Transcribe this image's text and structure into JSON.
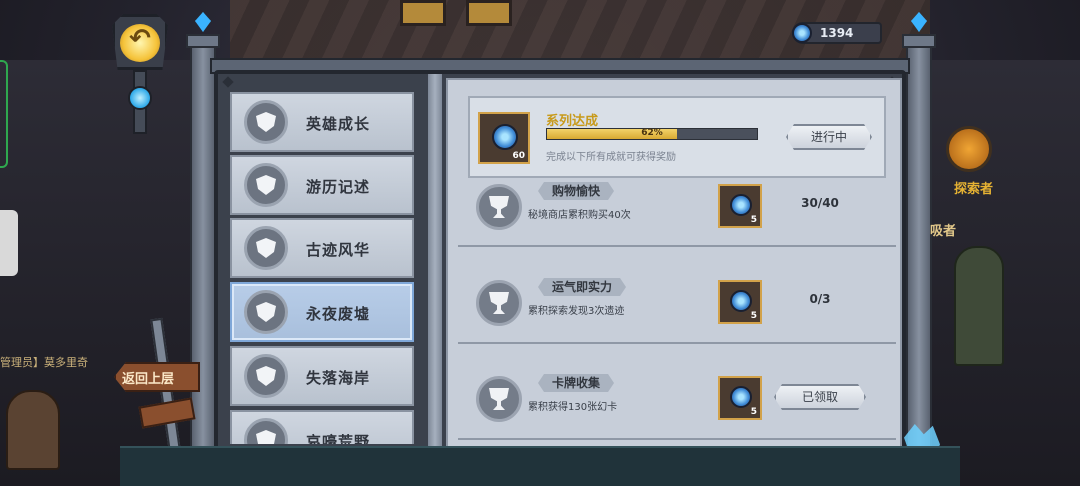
{
  "currency": {
    "icon": "gem-coin-icon",
    "value": "1394"
  },
  "navigation": {
    "back_label": "返回上层"
  },
  "categories": [
    {
      "label": "英雄成长",
      "icon": "helmet-icon",
      "selected": false
    },
    {
      "label": "游历记述",
      "icon": "book-icon",
      "selected": false
    },
    {
      "label": "古迹风华",
      "icon": "ruins-icon",
      "selected": false
    },
    {
      "label": "永夜废墟",
      "icon": "demon-mask-icon",
      "selected": true
    },
    {
      "label": "失落海岸",
      "icon": "mask-icon",
      "selected": false
    },
    {
      "label": "哀嚎荒野",
      "icon": "skull-icon",
      "selected": false
    }
  ],
  "series": {
    "title": "系列达成",
    "progress_percent": 62,
    "progress_label": "62%",
    "description": "完成以下所有成就可获得奖励",
    "reward_qty": "60",
    "status": "进行中"
  },
  "achievements": [
    {
      "name": "购物愉快",
      "description": "秘境商店累积购买40次",
      "reward_qty": "5",
      "progress": "30/40",
      "claimed": false
    },
    {
      "name": "运气即实力",
      "description": "累积探索发现3次遗迹",
      "reward_qty": "5",
      "progress": "0/3",
      "claimed": false
    },
    {
      "name": "卡牌收集",
      "description": "累积获得130张幻卡",
      "reward_qty": "5",
      "progress": "",
      "claimed": true,
      "claimed_label": "已领取"
    }
  ],
  "side": {
    "explorer_label": "探索者",
    "partial_label": "吸者",
    "left_partial_label": "管理员】莫多里奇"
  },
  "colors": {
    "accent_gold": "#c89a1a",
    "progress_fill": "#e2b540",
    "selected_tab": "#a8bfdc"
  }
}
